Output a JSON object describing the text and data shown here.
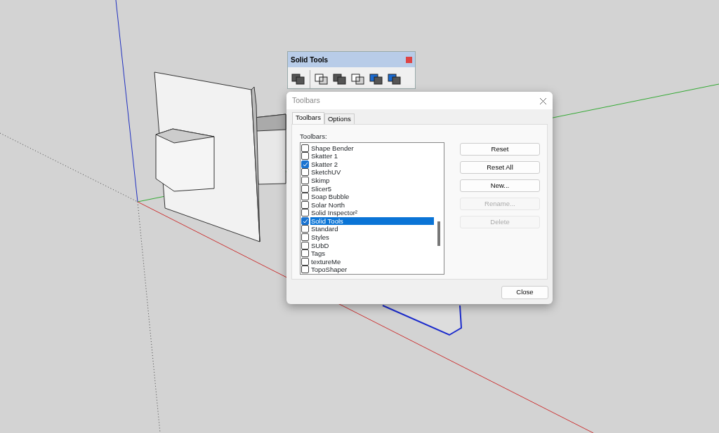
{
  "toolbar_window": {
    "title": "Solid Tools"
  },
  "dialog": {
    "title": "Toolbars",
    "tabs": [
      {
        "label": "Toolbars",
        "selected": true
      },
      {
        "label": "Options",
        "selected": false
      }
    ],
    "list_label": "Toolbars:",
    "items": [
      {
        "label": "Shape Bender",
        "checked": false,
        "selected": false
      },
      {
        "label": "Skatter 1",
        "checked": false,
        "selected": false
      },
      {
        "label": "Skatter 2",
        "checked": true,
        "selected": false
      },
      {
        "label": "SketchUV",
        "checked": false,
        "selected": false
      },
      {
        "label": "Skimp",
        "checked": false,
        "selected": false
      },
      {
        "label": "Slicer5",
        "checked": false,
        "selected": false
      },
      {
        "label": "Soap Bubble",
        "checked": false,
        "selected": false
      },
      {
        "label": "Solar North",
        "checked": false,
        "selected": false
      },
      {
        "label": "Solid Inspector²",
        "checked": false,
        "selected": false
      },
      {
        "label": "Solid Tools",
        "checked": true,
        "selected": true
      },
      {
        "label": "Standard",
        "checked": false,
        "selected": false
      },
      {
        "label": "Styles",
        "checked": false,
        "selected": false
      },
      {
        "label": "SUbD",
        "checked": false,
        "selected": false
      },
      {
        "label": "Tags",
        "checked": false,
        "selected": false
      },
      {
        "label": "textureMe",
        "checked": false,
        "selected": false
      },
      {
        "label": "TopoShaper",
        "checked": false,
        "selected": false
      }
    ],
    "buttons": [
      {
        "label": "Reset",
        "disabled": false
      },
      {
        "label": "Reset All",
        "disabled": false
      },
      {
        "label": "New...",
        "disabled": false
      },
      {
        "label": "Rename...",
        "disabled": true
      },
      {
        "label": "Delete",
        "disabled": true
      }
    ],
    "close_button": "Close"
  }
}
